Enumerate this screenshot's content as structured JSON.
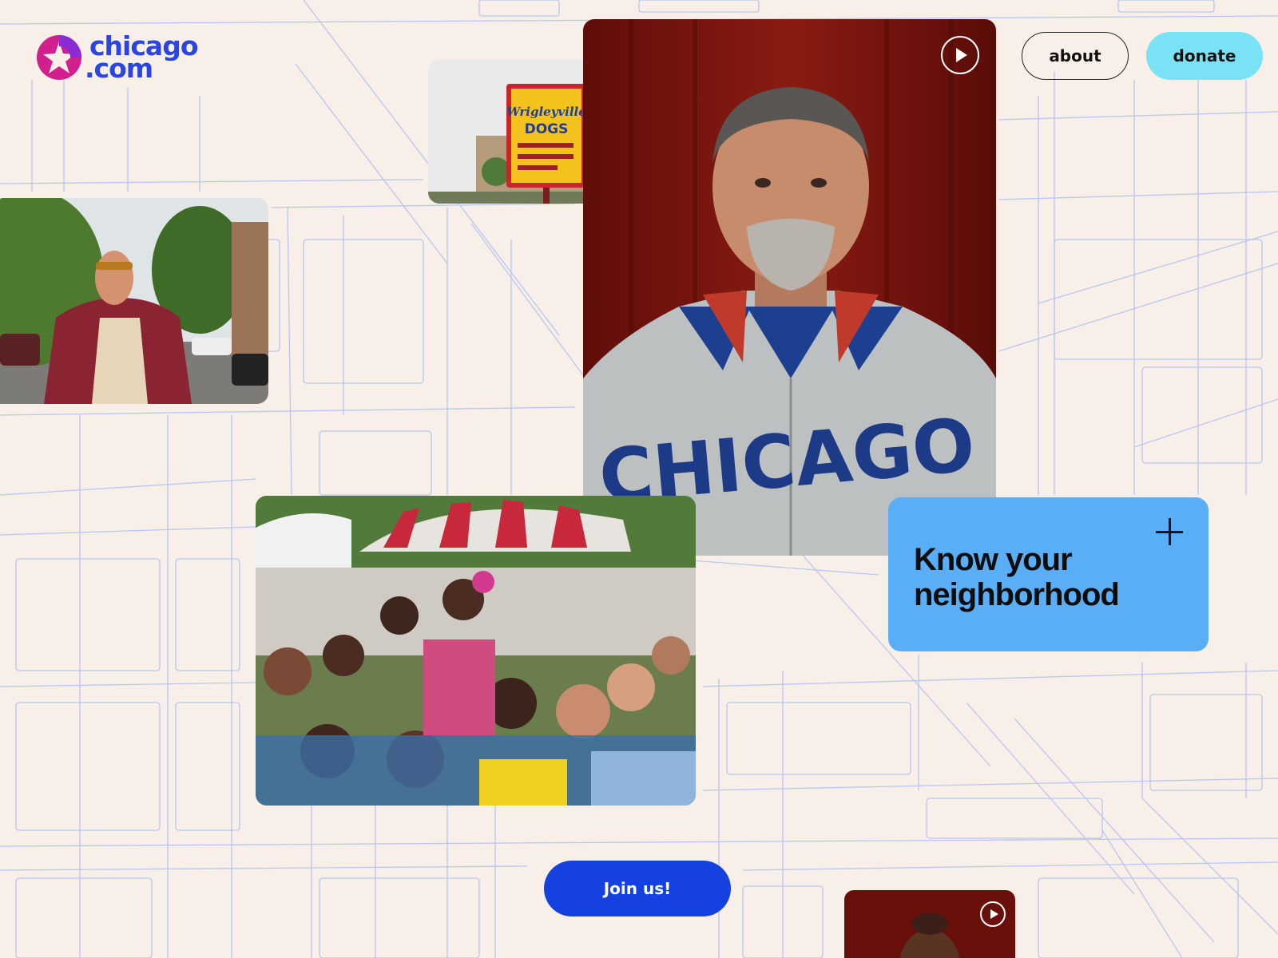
{
  "brand": {
    "name_line1": "chicago",
    "name_line2": ".com",
    "logo_icon": "star-burst-logo"
  },
  "nav": {
    "about_label": "about",
    "donate_label": "donate"
  },
  "feature_card": {
    "title": "Know your neighborhood",
    "expand_icon": "plus-icon"
  },
  "cta": {
    "join_label": "Join us!"
  },
  "media": {
    "hotdog_sign": {
      "alt": "Wrigleyville Dogs sign",
      "sign_line1": "Wrigleyville",
      "sign_line2": "DOGS"
    },
    "jacket_man": {
      "alt": "Man in leather jacket on street"
    },
    "main_portrait": {
      "alt": "Man in Chicago track jacket",
      "jacket_text": "CHICAGO",
      "play_icon": "play-icon"
    },
    "crowd": {
      "alt": "Festival crowd"
    },
    "woman_portrait": {
      "alt": "Woman portrait",
      "play_icon": "play-icon"
    }
  },
  "colors": {
    "background": "#f8efe8",
    "map_lines": "#b9c6f2",
    "brand_blue": "#2b45e0",
    "brand_magenta": "#d1208e",
    "donate_cyan": "#79e3f5",
    "card_blue": "#5aaef6",
    "join_blue": "#1541e0"
  }
}
